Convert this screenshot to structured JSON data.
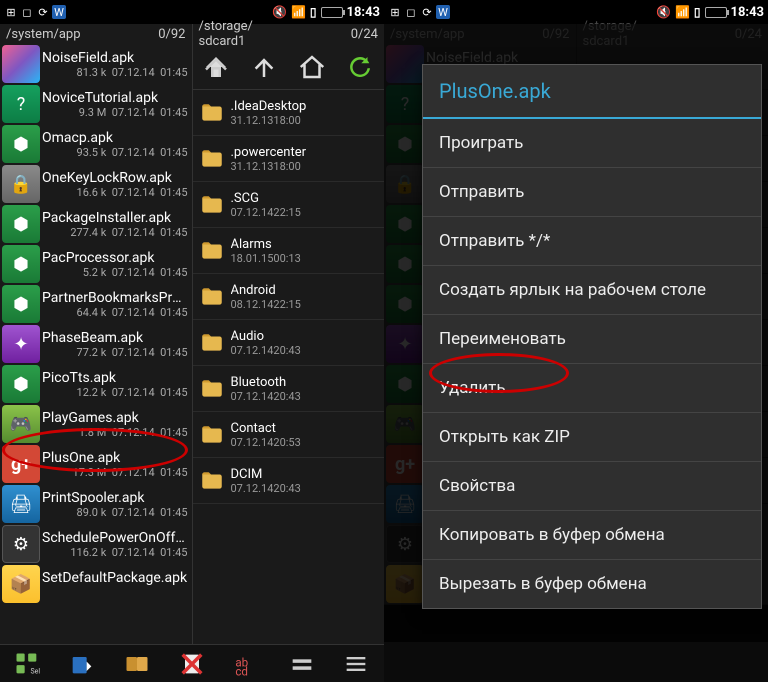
{
  "status": {
    "time": "18:43"
  },
  "left": {
    "pathA": "/system/app",
    "countA": "0/92",
    "pathB": "/storage/\nsdcard1",
    "countB": "0/24",
    "files": [
      {
        "name": "NoiseField.apk",
        "size": "81.3 k",
        "date": "07.12.14",
        "time": "01:45",
        "cls": "bgPink",
        "glyph": ""
      },
      {
        "name": "NoviceTutorial.apk",
        "size": "9.3 M",
        "date": "07.12.14",
        "time": "01:45",
        "cls": "bgB",
        "glyph": "?"
      },
      {
        "name": "Omacp.apk",
        "size": "93.5 k",
        "date": "07.12.14",
        "time": "01:45",
        "cls": "bgA",
        "glyph": "⬢"
      },
      {
        "name": "OneKeyLockRow.apk",
        "size": "16.6 k",
        "date": "07.12.14",
        "time": "01:45",
        "cls": "bgD",
        "glyph": "🔒"
      },
      {
        "name": "PackageInstaller.apk",
        "size": "277.4 k",
        "date": "07.12.14",
        "time": "01:45",
        "cls": "bgA",
        "glyph": "⬢"
      },
      {
        "name": "PacProcessor.apk",
        "size": "5.2 k",
        "date": "07.12.14",
        "time": "01:45",
        "cls": "bgA",
        "glyph": "⬢"
      },
      {
        "name": "PartnerBookmarksProvider.apk",
        "size": "64.4 k",
        "date": "07.12.14",
        "time": "01:45",
        "cls": "bgA",
        "glyph": "⬢"
      },
      {
        "name": "PhaseBeam.apk",
        "size": "77.2 k",
        "date": "07.12.14",
        "time": "01:45",
        "cls": "bgC",
        "glyph": "✦"
      },
      {
        "name": "PicoTts.apk",
        "size": "12.2 k",
        "date": "07.12.14",
        "time": "01:45",
        "cls": "bgA",
        "glyph": "⬢"
      },
      {
        "name": "PlayGames.apk",
        "size": "1.8 M",
        "date": "07.12.14",
        "time": "01:45",
        "cls": "bgE",
        "glyph": "🎮"
      },
      {
        "name": "PlusOne.apk",
        "size": "17.3 M",
        "date": "07.12.14",
        "time": "01:45",
        "cls": "bgRed",
        "glyph": "g+"
      },
      {
        "name": "PrintSpooler.apk",
        "size": "89.0 k",
        "date": "07.12.14",
        "time": "01:45",
        "cls": "bgBlue",
        "glyph": "🖨"
      },
      {
        "name": "SchedulePowerOnOff.apk",
        "size": "116.2 k",
        "date": "07.12.14",
        "time": "01:45",
        "cls": "bgDark",
        "glyph": "⚙"
      },
      {
        "name": "SetDefaultPackage.apk",
        "size": "",
        "date": "",
        "time": "",
        "cls": "bgYellow",
        "glyph": "📦"
      }
    ],
    "dirs": [
      {
        "name": ".IdeaDesktop",
        "dir": "<dir>",
        "date": "31.12.13",
        "time": "18:00"
      },
      {
        "name": ".powercenter",
        "dir": "<dir>",
        "date": "31.12.13",
        "time": "18:00"
      },
      {
        "name": ".SCG",
        "dir": "<dir>",
        "date": "07.12.14",
        "time": "22:15"
      },
      {
        "name": "Alarms",
        "dir": "<dir>",
        "date": "18.01.15",
        "time": "00:13"
      },
      {
        "name": "Android",
        "dir": "<dir>",
        "date": "08.12.14",
        "time": "22:15"
      },
      {
        "name": "Audio",
        "dir": "<dir>",
        "date": "07.12.14",
        "time": "20:43"
      },
      {
        "name": "Bluetooth",
        "dir": "<dir>",
        "date": "07.12.14",
        "time": "20:43"
      },
      {
        "name": "Contact",
        "dir": "<dir>",
        "date": "07.12.14",
        "time": "20:53"
      },
      {
        "name": "DCIM",
        "dir": "<dir>",
        "date": "07.12.14",
        "time": "20:43"
      }
    ]
  },
  "menu": {
    "title": "PlusOne.apk",
    "items": [
      "Проиграть",
      "Отправить",
      "Отправить */*",
      "Создать ярлык на рабочем столе",
      "Переименовать",
      "Удалить",
      "Открыть как ZIP",
      "Свойства",
      "Копировать в буфер обмена",
      "Вырезать в буфер обмена"
    ]
  }
}
